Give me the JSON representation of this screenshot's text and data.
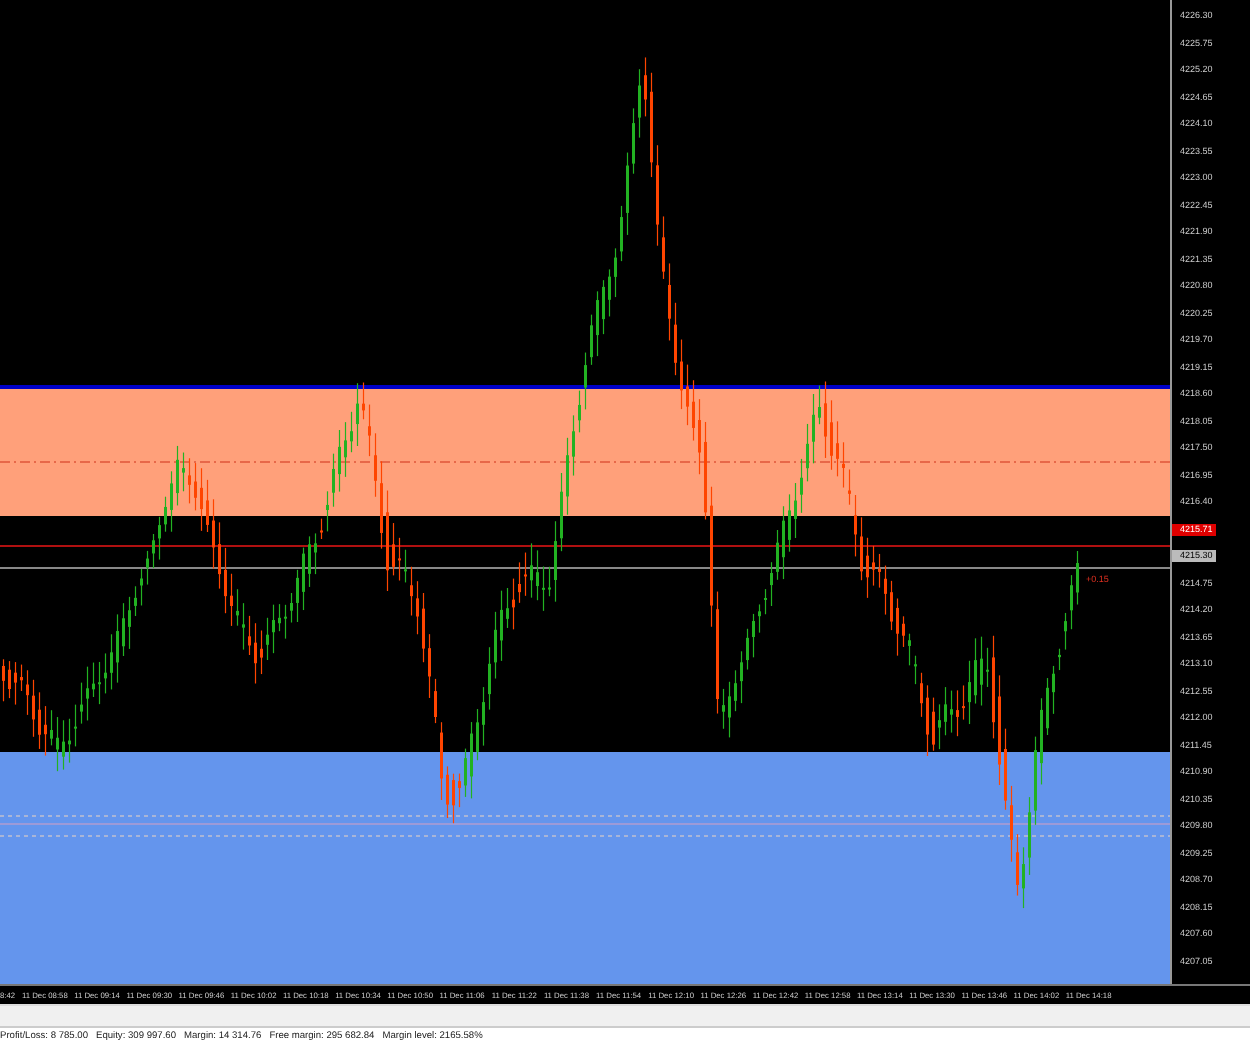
{
  "chart": {
    "price_axis": [
      {
        "kind": "tick",
        "label": "4226.30"
      },
      {
        "kind": "tick",
        "label": "4225.75"
      },
      {
        "kind": "tick",
        "label": "4225.20"
      },
      {
        "kind": "tick",
        "label": "4224.65"
      },
      {
        "kind": "tick",
        "label": "4224.10"
      },
      {
        "kind": "tick",
        "label": "4223.55"
      },
      {
        "kind": "tick",
        "label": "4223.00"
      },
      {
        "kind": "tick",
        "label": "4222.45"
      },
      {
        "kind": "tick",
        "label": "4221.90"
      },
      {
        "kind": "tick",
        "label": "4221.35"
      },
      {
        "kind": "tick",
        "label": "4220.80"
      },
      {
        "kind": "tick",
        "label": "4220.25"
      },
      {
        "kind": "tick",
        "label": "4219.70"
      },
      {
        "kind": "tick",
        "label": "4219.15"
      },
      {
        "kind": "tick",
        "label": "4218.60"
      },
      {
        "kind": "tick",
        "label": "4218.05"
      },
      {
        "kind": "tick",
        "label": "4217.50"
      },
      {
        "kind": "tick",
        "label": "4216.95"
      },
      {
        "kind": "tick",
        "label": "4216.40"
      },
      {
        "kind": "bid",
        "label": "4215.71"
      },
      {
        "kind": "ask",
        "label": "4215.30"
      },
      {
        "kind": "tick",
        "label": "4214.75"
      },
      {
        "kind": "tick",
        "label": "4214.20"
      },
      {
        "kind": "tick",
        "label": "4213.65"
      },
      {
        "kind": "tick",
        "label": "4213.10"
      },
      {
        "kind": "tick",
        "label": "4212.55"
      },
      {
        "kind": "tick",
        "label": "4212.00"
      },
      {
        "kind": "tick",
        "label": "4211.45"
      },
      {
        "kind": "tick",
        "label": "4210.90"
      },
      {
        "kind": "tick",
        "label": "4210.35"
      },
      {
        "kind": "tick",
        "label": "4209.80"
      },
      {
        "kind": "tick",
        "label": "4209.25"
      },
      {
        "kind": "tick",
        "label": "4208.70"
      },
      {
        "kind": "tick",
        "label": "4208.15"
      },
      {
        "kind": "tick",
        "label": "4207.60"
      },
      {
        "kind": "tick",
        "label": "4207.05"
      }
    ],
    "profit_label": "+0.15",
    "time_axis": [
      "8:42",
      "11 Dec 08:58",
      "11 Dec 09:14",
      "11 Dec 09:30",
      "11 Dec 09:46",
      "11 Dec 10:02",
      "11 Dec 10:18",
      "11 Dec 10:34",
      "11 Dec 10:50",
      "11 Dec 11:06",
      "11 Dec 11:22",
      "11 Dec 11:38",
      "11 Dec 11:54",
      "11 Dec 12:10",
      "11 Dec 12:26",
      "11 Dec 12:42",
      "11 Dec 12:58",
      "11 Dec 13:14",
      "11 Dec 13:30",
      "11 Dec 13:46",
      "11 Dec 14:02",
      "11 Dec 14:18"
    ]
  },
  "status_bar": {
    "items": [
      {
        "label": "Profit/Loss:",
        "value": "8 785.00"
      },
      {
        "label": "Equity:",
        "value": "309 997.60"
      },
      {
        "label": "Margin:",
        "value": "14 314.76"
      },
      {
        "label": "Free margin:",
        "value": "295 682.84"
      },
      {
        "label": "Margin level:",
        "value": "2165.58%"
      }
    ]
  }
}
